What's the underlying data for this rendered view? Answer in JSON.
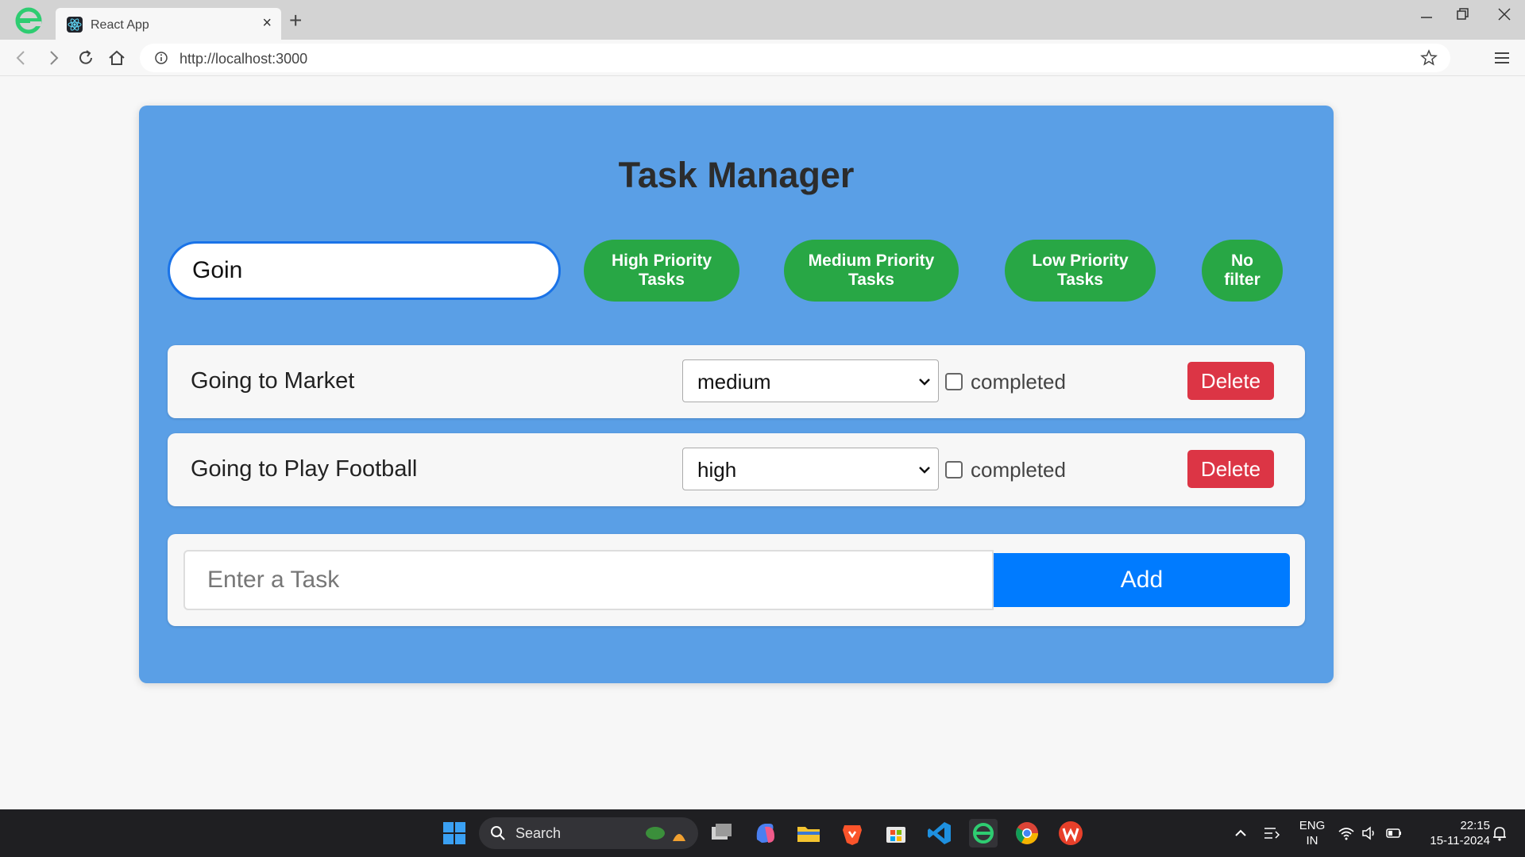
{
  "browser": {
    "tab_title": "React App",
    "tab_close": "×",
    "new_tab": "+",
    "url": "http://localhost:3000"
  },
  "app": {
    "title": "Task Manager",
    "search": {
      "value": "Goin"
    },
    "filters": [
      {
        "label": "High Priority Tasks"
      },
      {
        "label": "Medium Priority Tasks"
      },
      {
        "label": "Low Priority Tasks"
      },
      {
        "label": "No filter"
      }
    ],
    "tasks": [
      {
        "name": "Going to Market",
        "priority": "medium",
        "completed_label": "completed",
        "delete_label": "Delete"
      },
      {
        "name": "Going to Play Football",
        "priority": "high",
        "completed_label": "completed",
        "delete_label": "Delete"
      }
    ],
    "new_task": {
      "placeholder": "Enter a Task",
      "add_label": "Add"
    }
  },
  "taskbar": {
    "search_label": "Search",
    "lang_1": "ENG",
    "lang_2": "IN",
    "time": "22:15",
    "date": "15-11-2024"
  },
  "colors": {
    "app_bg": "#5a9fe6",
    "filter_green": "#28a745",
    "delete_red": "#dc3545",
    "add_blue": "#007bff"
  }
}
